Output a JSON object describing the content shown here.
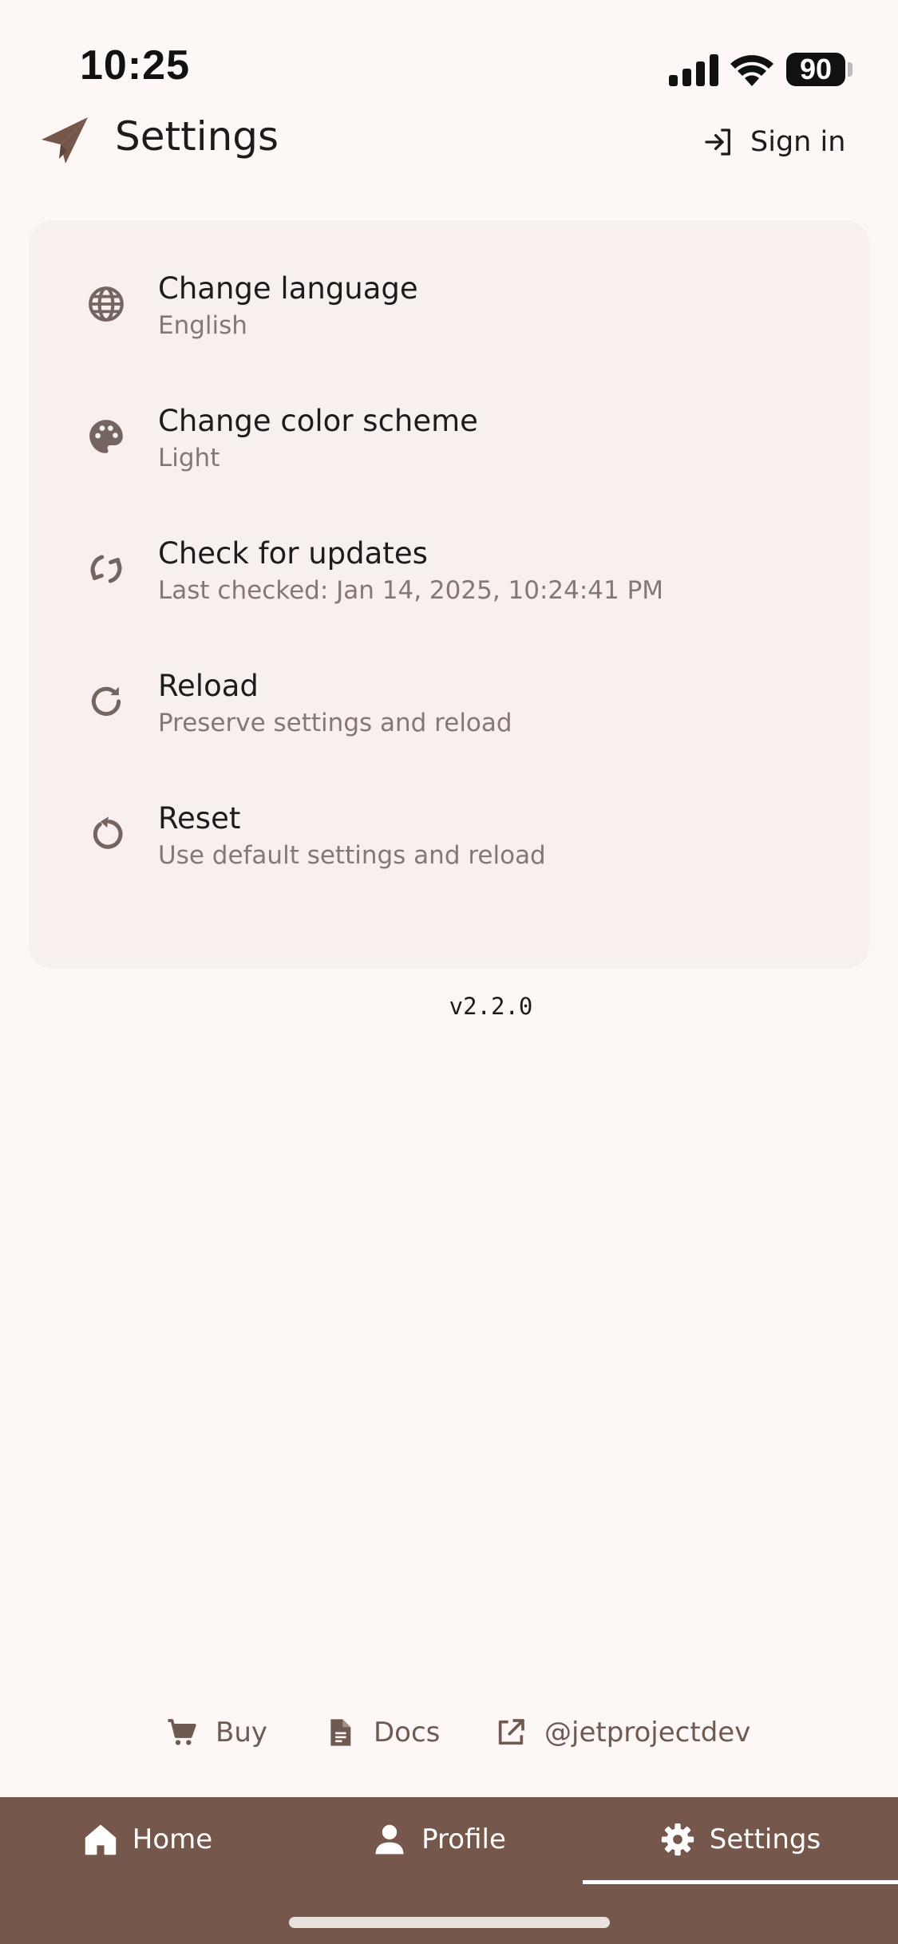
{
  "status_bar": {
    "time": "10:25",
    "battery": "90",
    "icons": [
      "signal-icon",
      "wifi-icon",
      "battery-icon"
    ]
  },
  "header": {
    "title": "Settings",
    "logo_icon": "paper-plane-icon",
    "sign_in_label": "Sign in",
    "sign_in_icon": "login-icon"
  },
  "settings": {
    "items": [
      {
        "title": "Change language",
        "subtitle": "English",
        "icon": "globe-icon"
      },
      {
        "title": "Change color scheme",
        "subtitle": "Light",
        "icon": "palette-icon"
      },
      {
        "title": "Check for updates",
        "subtitle": "Last checked: Jan 14, 2025, 10:24:41 PM",
        "icon": "sync-icon"
      },
      {
        "title": "Reload",
        "subtitle": "Preserve settings and reload",
        "icon": "reload-icon"
      },
      {
        "title": "Reset",
        "subtitle": "Use default settings and reload",
        "icon": "reset-icon"
      }
    ]
  },
  "version": "v2.2.0",
  "footer_links": [
    {
      "label": "Buy",
      "icon": "cart-icon"
    },
    {
      "label": "Docs",
      "icon": "document-icon"
    },
    {
      "label": "@jetprojectdev",
      "icon": "external-link-icon"
    }
  ],
  "bottom_nav": {
    "items": [
      {
        "label": "Home",
        "icon": "home-icon",
        "active": false
      },
      {
        "label": "Profile",
        "icon": "person-icon",
        "active": false
      },
      {
        "label": "Settings",
        "icon": "gear-icon",
        "active": true
      }
    ]
  },
  "colors": {
    "background": "#FDF7F5",
    "card": "#F7F0EE",
    "nav_background": "#75574B",
    "accent": "#75574B",
    "icon": "#756560",
    "subtitle": "#857874"
  }
}
